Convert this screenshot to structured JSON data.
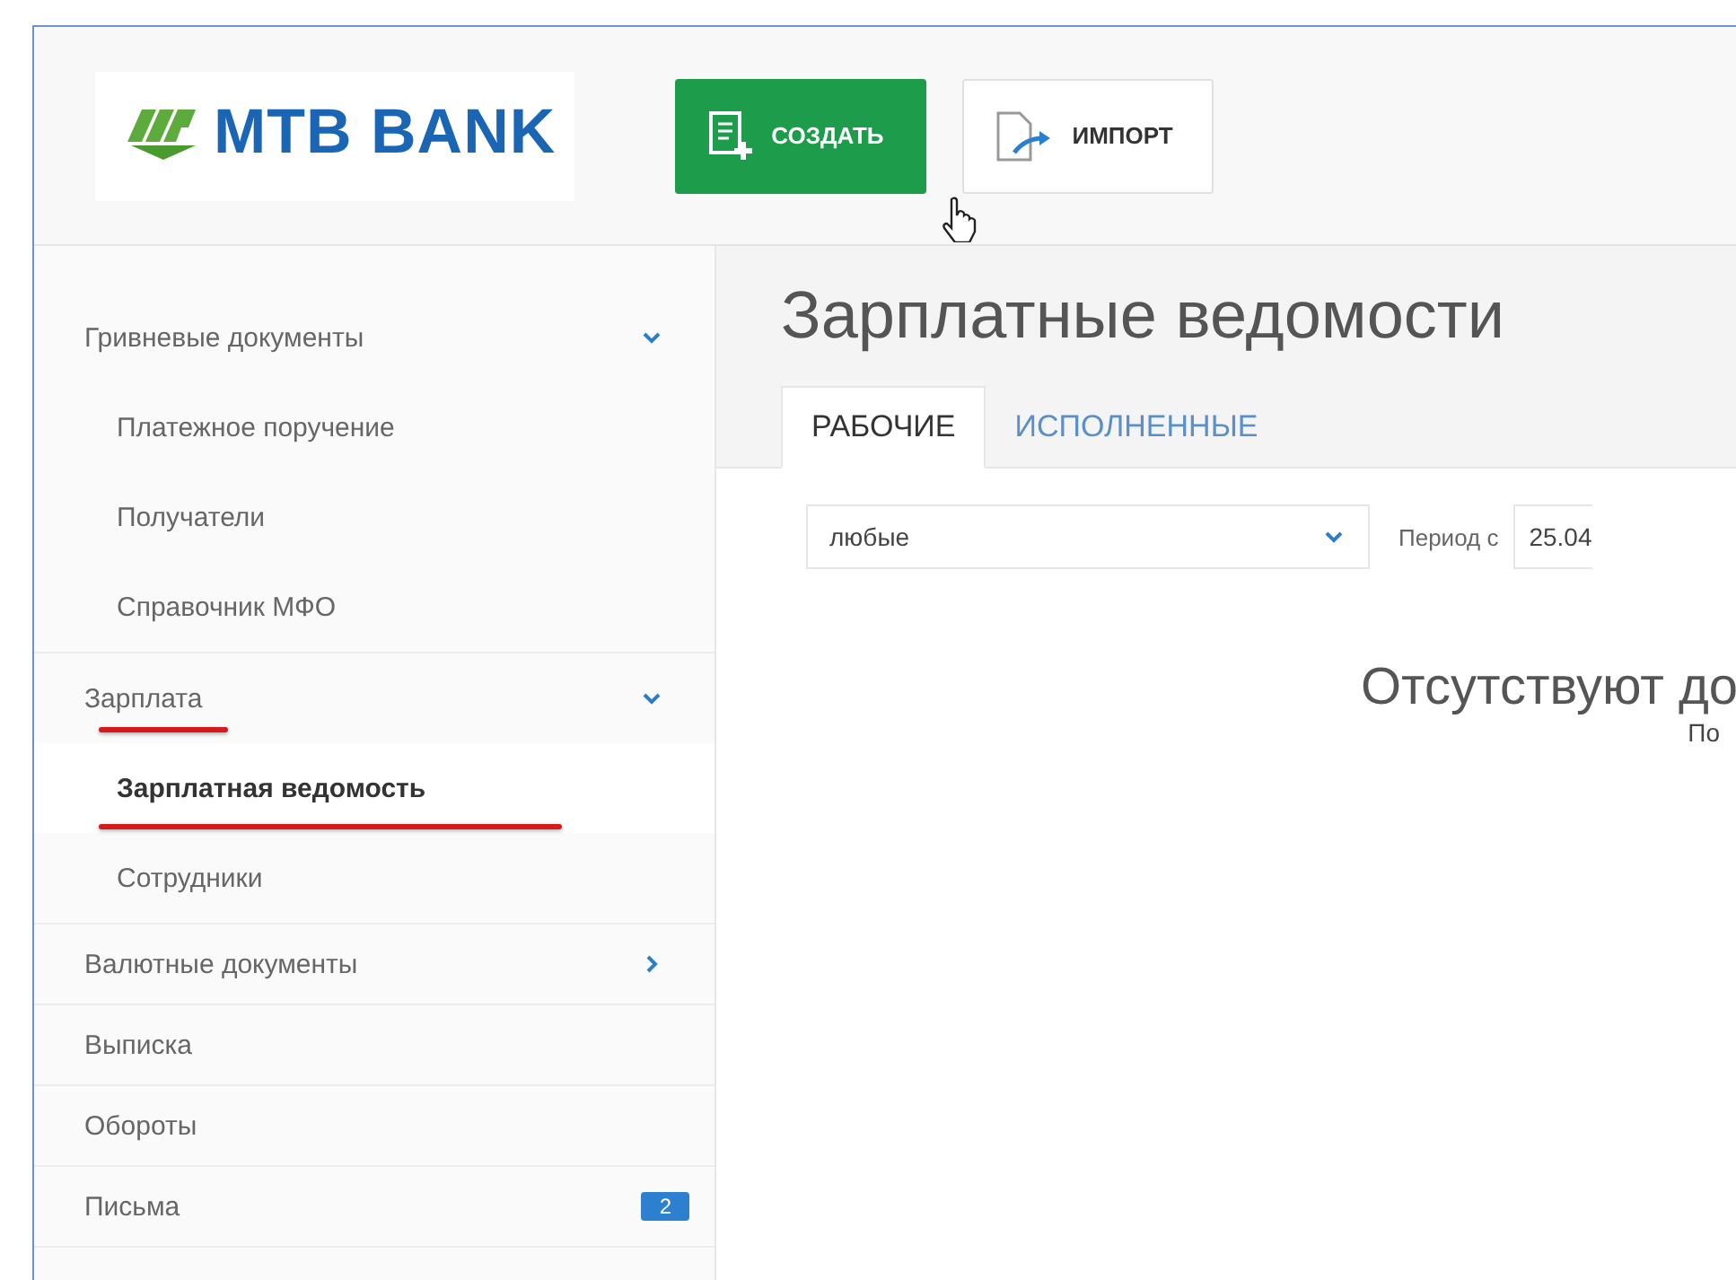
{
  "header": {
    "logo": "MTB BANK",
    "buttons": [
      {
        "kind": "create",
        "label": "СОЗДАТЬ"
      },
      {
        "kind": "import",
        "label": "ИМПОРТ"
      }
    ]
  },
  "sidebar": {
    "items": [
      {
        "label": "Гривневые документы",
        "expanded": true,
        "selected": false,
        "annotated": false,
        "children": [
          {
            "label": "Платежное поручение",
            "selected": false,
            "annotated": false
          },
          {
            "label": "Получатели",
            "selected": false,
            "annotated": false
          },
          {
            "label": "Справочник МФО",
            "selected": false,
            "annotated": false
          }
        ]
      },
      {
        "label": "Зарплата",
        "expanded": true,
        "selected": false,
        "annotated": true,
        "children": [
          {
            "label": "Зарплатная ведомость",
            "selected": true,
            "annotated": true
          },
          {
            "label": "Сотрудники",
            "selected": false,
            "annotated": false
          }
        ]
      },
      {
        "label": "Валютные документы",
        "expanded": false,
        "selected": false,
        "annotated": false
      },
      {
        "label": "Выписка",
        "selected": false,
        "annotated": false
      },
      {
        "label": "Обороты",
        "selected": false,
        "annotated": false
      },
      {
        "label": "Письма",
        "selected": false,
        "annotated": false,
        "badge": "2"
      }
    ]
  },
  "main": {
    "title": "Зарплатные ведомости",
    "tabs": [
      {
        "label": "РАБОЧИЕ",
        "selected": true
      },
      {
        "label": "ИСПОЛНЕННЫЕ",
        "selected": false
      }
    ],
    "filter": {
      "value": "любые"
    },
    "period": {
      "label": "Период с",
      "value": "25.04"
    },
    "empty": {
      "title": "Отсутствуют до",
      "hint": "По"
    }
  }
}
